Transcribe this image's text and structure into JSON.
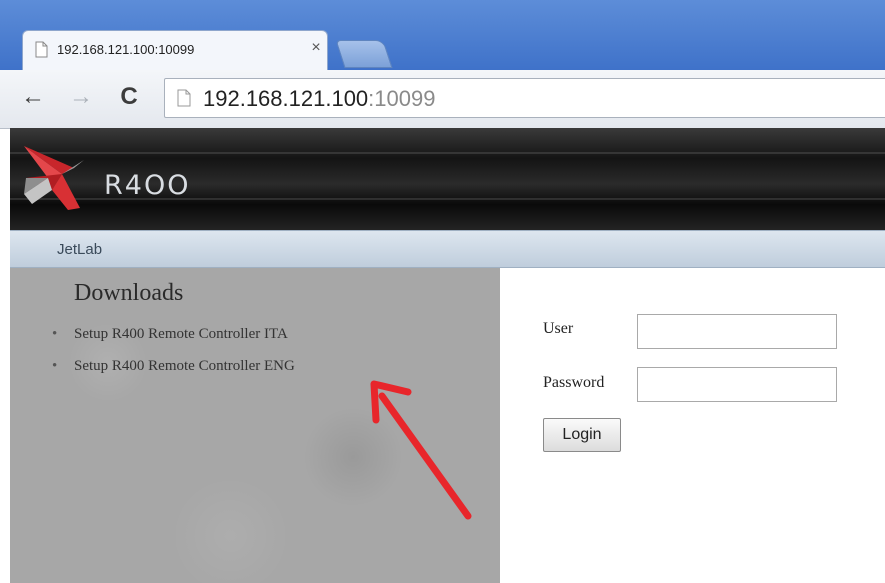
{
  "browser": {
    "tab_title": "192.168.121.100:10099",
    "tab_close": "×",
    "url_host": "192.168.121.100",
    "url_port": ":10099",
    "back_icon": "←",
    "forward_icon": "→",
    "reload_icon": "C"
  },
  "banner": {
    "logo_text": "R4OO"
  },
  "nav": {
    "items": [
      {
        "label": "JetLab"
      }
    ]
  },
  "downloads": {
    "heading": "Downloads",
    "items": [
      {
        "label": "Setup R400 Remote Controller ITA"
      },
      {
        "label": "Setup R400 Remote Controller ENG"
      }
    ]
  },
  "login": {
    "user_label": "User",
    "password_label": "Password",
    "user_value": "",
    "password_value": "",
    "button_label": "Login"
  },
  "annotation": {
    "arrow_color": "#e8262b"
  }
}
